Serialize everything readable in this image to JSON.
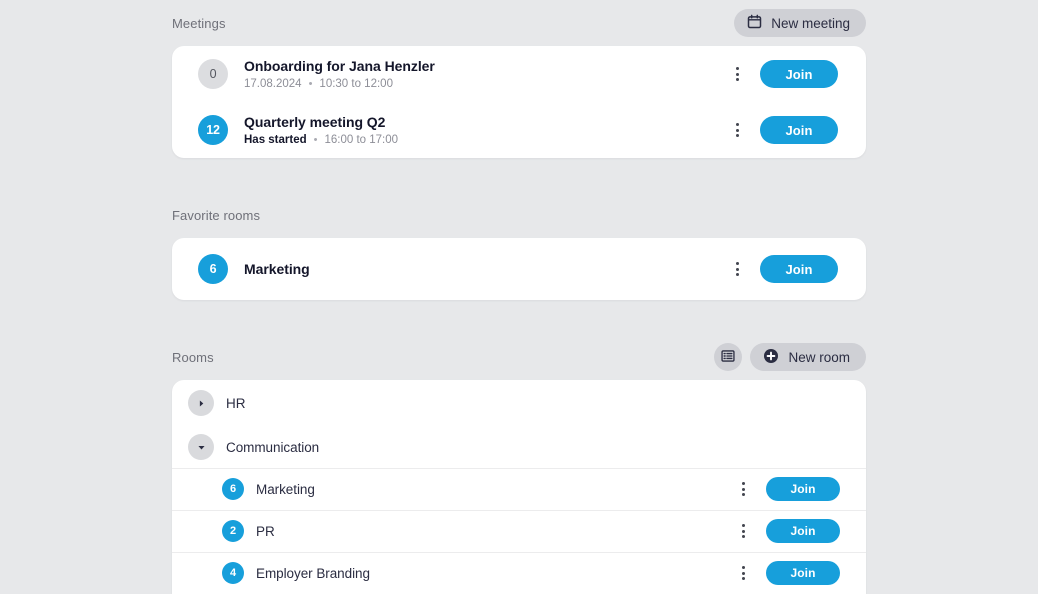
{
  "theme": {
    "page_background": "#e7e8ea",
    "card_background": "#ffffff",
    "accent_blue": "#179fdb",
    "button_grey": "#cfd0d5",
    "text_dark": "#14162a",
    "text_muted": "#8d8e97",
    "label_grey": "#6f7079"
  },
  "sections": {
    "meetings": {
      "title": "Meetings",
      "new_meeting_label": "New meeting",
      "new_meeting_icon": "calendar-icon",
      "items": [
        {
          "badge": "0",
          "badge_style": "grey",
          "title": "Onboarding for Jana Henzler",
          "sub_strong": "17.08.2024",
          "sub_separator": "•",
          "sub_time": "10:30 to 12:00",
          "sub_strong_is_bold": false,
          "menu_icon": "kebab-menu-icon",
          "join_label": "Join"
        },
        {
          "badge": "12",
          "badge_style": "blue",
          "title": "Quarterly meeting Q2",
          "sub_strong": "Has started",
          "sub_separator": "•",
          "sub_time": "16:00 to 17:00",
          "sub_strong_is_bold": true,
          "menu_icon": "kebab-menu-icon",
          "join_label": "Join"
        }
      ]
    },
    "favorite_rooms": {
      "title": "Favorite rooms",
      "items": [
        {
          "badge": "6",
          "name": "Marketing",
          "menu_icon": "kebab-menu-icon",
          "join_label": "Join"
        }
      ]
    },
    "rooms": {
      "title": "Rooms",
      "list_view_icon": "list-view-icon",
      "new_room_label": "New room",
      "new_room_icon": "plus-circle-icon",
      "groups": [
        {
          "name": "HR",
          "expanded": false,
          "caret_icon": "chevron-right-icon",
          "children": []
        },
        {
          "name": "Communication",
          "expanded": true,
          "caret_icon": "chevron-down-icon",
          "children": [
            {
              "badge": "6",
              "name": "Marketing",
              "menu_icon": "kebab-menu-icon",
              "join_label": "Join"
            },
            {
              "badge": "2",
              "name": "PR",
              "menu_icon": "kebab-menu-icon",
              "join_label": "Join"
            },
            {
              "badge": "4",
              "name": "Employer Branding",
              "menu_icon": "kebab-menu-icon",
              "join_label": "Join"
            }
          ]
        }
      ]
    }
  }
}
